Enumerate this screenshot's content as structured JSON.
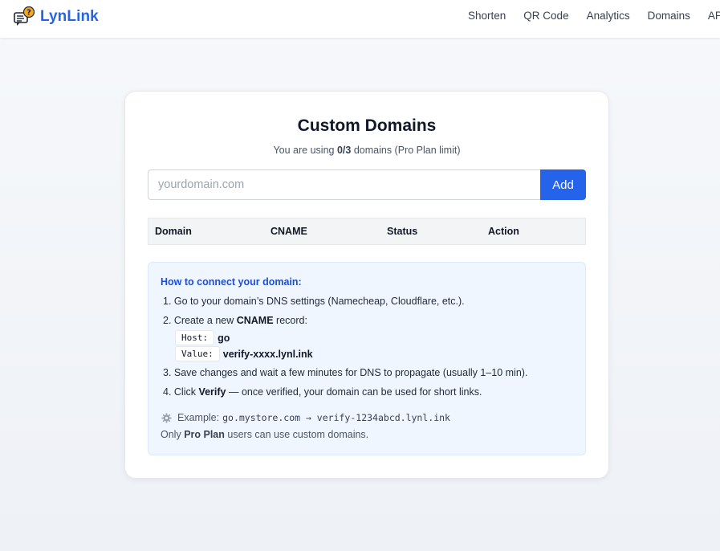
{
  "brand": {
    "name": "LynLink",
    "icon": "chat-question-icon"
  },
  "nav": [
    {
      "label": "Shorten"
    },
    {
      "label": "QR Code"
    },
    {
      "label": "Analytics"
    },
    {
      "label": "Domains"
    },
    {
      "label": "API"
    }
  ],
  "card": {
    "title": "Custom Domains",
    "subtitle_prefix": "You are using ",
    "usage": "0/3",
    "subtitle_suffix": " domains (Pro Plan limit)"
  },
  "form": {
    "placeholder": "yourdomain.com",
    "value": "",
    "add_label": "Add"
  },
  "table": {
    "headers": [
      "Domain",
      "CNAME",
      "Status",
      "Action"
    ],
    "rows": []
  },
  "help": {
    "title": "How to connect your domain:",
    "step1": "1. Go to your domain’s DNS settings (Namecheap, Cloudflare, etc.).",
    "step2_prefix": "2. Create a new ",
    "step2_bold": "CNAME",
    "step2_suffix": " record:",
    "host_label": "Host:",
    "host_value": "go",
    "value_label": "Value:",
    "value_value": "verify-xxxx.lynl.ink",
    "step3": "3. Save changes and wait a few minutes for DNS to propagate (usually 1–10 min).",
    "step4_prefix": "4. Click ",
    "step4_bold": "Verify",
    "step4_suffix": " — once verified, your domain can be used for short links.",
    "example_icon": "gear-icon",
    "example_label": "Example: ",
    "example_value": "go.mystore.com → verify-1234abcd.lynl.ink",
    "note_prefix": "Only ",
    "note_bold": "Pro Plan",
    "note_suffix": " users can use custom domains."
  },
  "colors": {
    "accent": "#2563eb",
    "help_title": "#1d4ed8",
    "help_bg": "#eff6ff"
  }
}
